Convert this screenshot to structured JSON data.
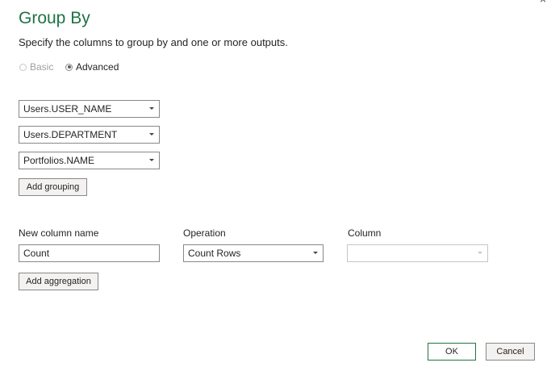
{
  "dialog": {
    "title": "Group By",
    "subtitle": "Specify the columns to group by and one or more outputs.",
    "close_icon": "close-icon"
  },
  "mode": {
    "basic_label": "Basic",
    "advanced_label": "Advanced",
    "selected": "Advanced"
  },
  "grouping": {
    "columns": [
      "Users.USER_NAME",
      "Users.DEPARTMENT",
      "Portfolios.NAME"
    ],
    "add_button": "Add grouping"
  },
  "aggregation": {
    "headers": {
      "new_column_name": "New column name",
      "operation": "Operation",
      "column": "Column"
    },
    "rows": [
      {
        "new_column_name": "Count",
        "operation": "Count Rows",
        "column": ""
      }
    ],
    "add_button": "Add aggregation"
  },
  "footer": {
    "ok": "OK",
    "cancel": "Cancel"
  },
  "colors": {
    "accent": "#217346"
  }
}
